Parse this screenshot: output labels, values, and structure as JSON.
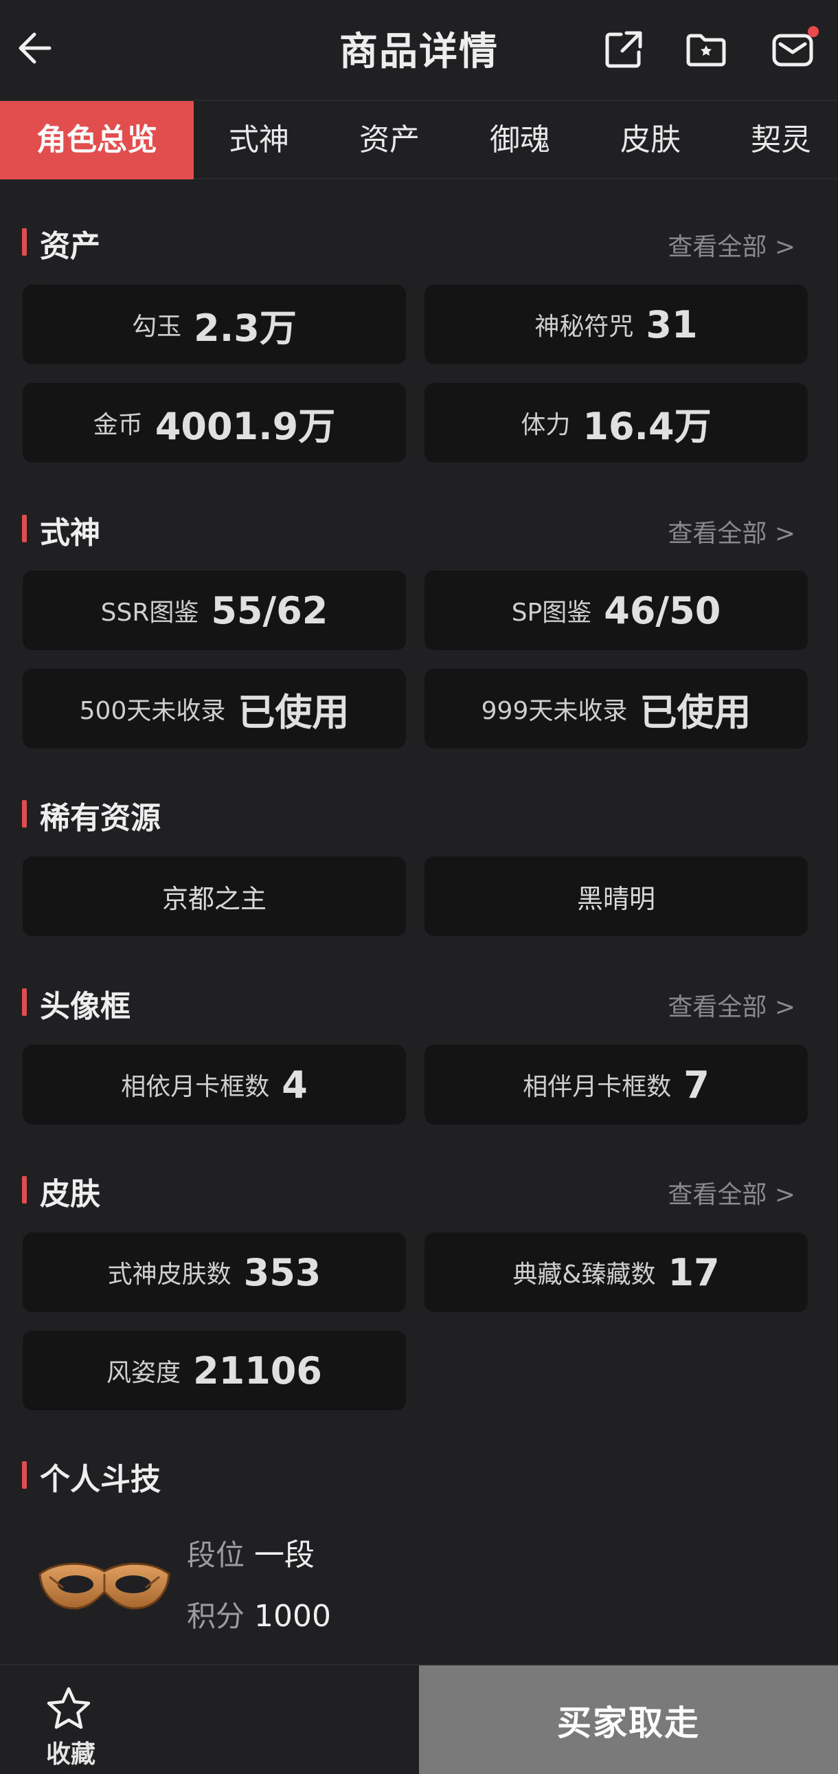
{
  "header": {
    "title": "商品详情",
    "icons": [
      "back-arrow-icon",
      "share-icon",
      "favorite-folder-icon",
      "mail-icon"
    ],
    "has_notification": true
  },
  "tabs": [
    {
      "label": "角色总览",
      "active": true
    },
    {
      "label": "式神",
      "active": false
    },
    {
      "label": "资产",
      "active": false
    },
    {
      "label": "御魂",
      "active": false
    },
    {
      "label": "皮肤",
      "active": false
    },
    {
      "label": "契灵",
      "active": false
    }
  ],
  "assets": {
    "title": "资产",
    "see_all": "查看全部 >",
    "items": [
      {
        "label": "勾玉",
        "value": "2.3万"
      },
      {
        "label": "神秘符咒",
        "value": "31"
      },
      {
        "label": "金币",
        "value": "4001.9万"
      },
      {
        "label": "体力",
        "value": "16.4万"
      }
    ]
  },
  "shikigami": {
    "title": "式神",
    "see_all": "查看全部 >",
    "items": [
      {
        "label": "SSR图鉴",
        "value": "55/62"
      },
      {
        "label": "SP图鉴",
        "value": "46/50"
      },
      {
        "label": "500天未收录",
        "value": "已使用"
      },
      {
        "label": "999天未收录",
        "value": "已使用"
      }
    ]
  },
  "rare": {
    "title": "稀有资源",
    "items": [
      "京都之主",
      "黑晴明"
    ]
  },
  "frames": {
    "title": "头像框",
    "see_all": "查看全部 >",
    "items": [
      {
        "label": "相依月卡框数",
        "value": "4"
      },
      {
        "label": "相伴月卡框数",
        "value": "7"
      }
    ]
  },
  "skins": {
    "title": "皮肤",
    "see_all": "查看全部 >",
    "items": [
      {
        "label": "式神皮肤数",
        "value": "353"
      },
      {
        "label": "典藏&臻藏数",
        "value": "17"
      },
      {
        "label": "风姿度",
        "value": "21106"
      }
    ]
  },
  "pvp": {
    "title": "个人斗技",
    "rank_label": "段位",
    "rank_value": "一段",
    "score_label": "积分",
    "score_value": "1000"
  },
  "bottom": {
    "collect_label": "收藏",
    "buy_label": "买家取走"
  },
  "colors": {
    "accent": "#e24d4d",
    "background": "#202022",
    "card": "#141415",
    "buy_button": "#7a7a7a"
  }
}
